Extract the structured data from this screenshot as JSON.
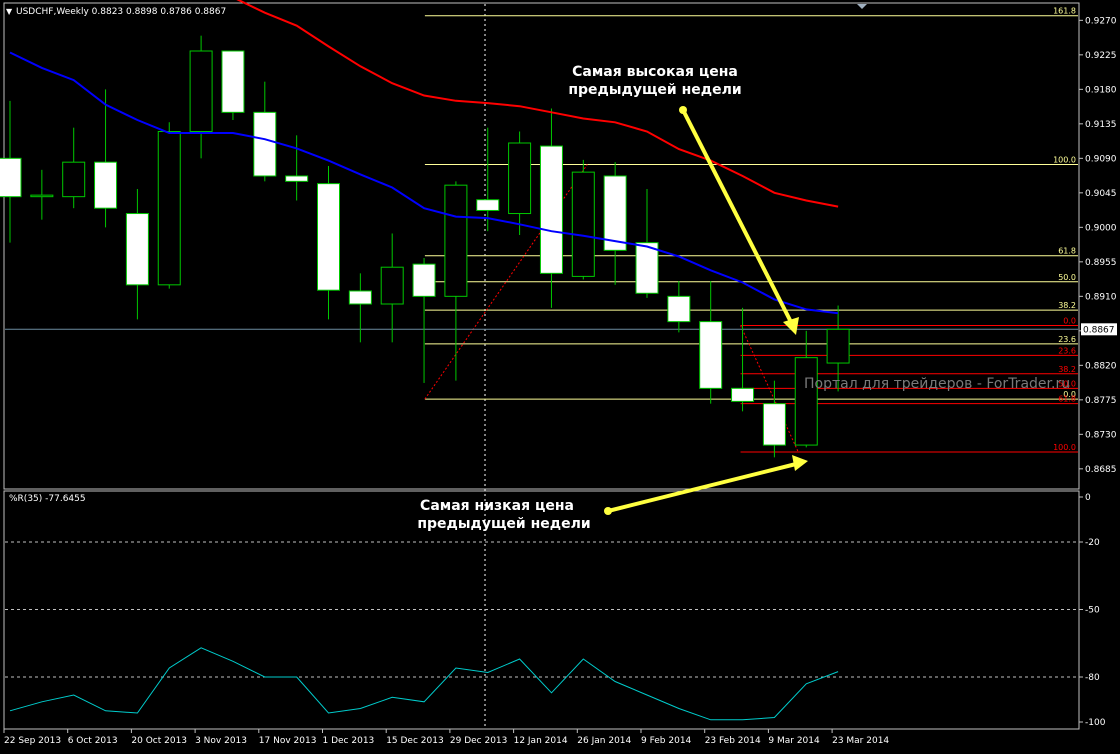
{
  "header": {
    "symbol_line": "USDCHF,Weekly  0.8823 0.8898 0.8786 0.8867",
    "menu_icon": "triangle-down-icon"
  },
  "indicator": {
    "title": "%R(35) -77.6455"
  },
  "watermark": "Портал для трейдеров - ForTrader.ru",
  "annotations": {
    "high_line1": "Самая высокая цена",
    "high_line2": "предыдущей недели",
    "low_line1": "Самая низкая цена",
    "low_line2": "предыдущей недели"
  },
  "colors": {
    "background": "#000000",
    "grid": "#c0c0c0",
    "candle_up": "#000000",
    "candle_down": "#ffffff",
    "candle_outline": "#00c800",
    "ma_fast": "#0000ff",
    "ma_slow": "#ff0000",
    "fib_main": "#ffff99",
    "fib_red": "#ff0000",
    "arrow": "#ffff40",
    "wpr_line": "#00cccc",
    "current_price": "#6c8ca0"
  },
  "chart_data": [
    {
      "type": "candlestick",
      "title": "USDCHF,Weekly",
      "ylim": [
        0.866,
        0.929
      ],
      "y_ticks": [
        "0.9270",
        "0.9225",
        "0.9180",
        "0.9135",
        "0.9090",
        "0.9045",
        "0.9000",
        "0.8955",
        "0.8910",
        "0.8865",
        "0.8820",
        "0.8775",
        "0.8730",
        "0.8685"
      ],
      "current_price_label": "0.8867",
      "x_tick_labels": [
        {
          "bar": 0,
          "label": "22 Sep 2013"
        },
        {
          "bar": 2,
          "label": "6 Oct 2013"
        },
        {
          "bar": 4,
          "label": "20 Oct 2013"
        },
        {
          "bar": 6,
          "label": "3 Nov 2013"
        },
        {
          "bar": 8,
          "label": "17 Nov 2013"
        },
        {
          "bar": 10,
          "label": "1 Dec 2013"
        },
        {
          "bar": 12,
          "label": "15 Dec 2013"
        },
        {
          "bar": 14,
          "label": "29 Dec 2013"
        },
        {
          "bar": 16,
          "label": "12 Jan 2014"
        },
        {
          "bar": 18,
          "label": "26 Jan 2014"
        },
        {
          "bar": 20,
          "label": "9 Feb 2014"
        },
        {
          "bar": 22,
          "label": "23 Feb 2014"
        },
        {
          "bar": 24,
          "label": "9 Mar 2014"
        },
        {
          "bar": 26,
          "label": "23 Mar 2014"
        }
      ],
      "candles": [
        {
          "o": 0.909,
          "h": 0.9165,
          "l": 0.898,
          "c": 0.904
        },
        {
          "o": 0.904,
          "h": 0.9075,
          "l": 0.901,
          "c": 0.9042
        },
        {
          "o": 0.904,
          "h": 0.913,
          "l": 0.9025,
          "c": 0.9085
        },
        {
          "o": 0.9085,
          "h": 0.918,
          "l": 0.9,
          "c": 0.9025
        },
        {
          "o": 0.9018,
          "h": 0.905,
          "l": 0.888,
          "c": 0.8925
        },
        {
          "o": 0.8925,
          "h": 0.9137,
          "l": 0.892,
          "c": 0.9125
        },
        {
          "o": 0.9125,
          "h": 0.925,
          "l": 0.909,
          "c": 0.923
        },
        {
          "o": 0.923,
          "h": 0.923,
          "l": 0.914,
          "c": 0.915
        },
        {
          "o": 0.915,
          "h": 0.919,
          "l": 0.906,
          "c": 0.9067
        },
        {
          "o": 0.9067,
          "h": 0.912,
          "l": 0.9035,
          "c": 0.906
        },
        {
          "o": 0.9057,
          "h": 0.908,
          "l": 0.888,
          "c": 0.8918
        },
        {
          "o": 0.8917,
          "h": 0.894,
          "l": 0.885,
          "c": 0.89
        },
        {
          "o": 0.89,
          "h": 0.8992,
          "l": 0.885,
          "c": 0.8948
        },
        {
          "o": 0.8952,
          "h": 0.896,
          "l": 0.8797,
          "c": 0.891
        },
        {
          "o": 0.891,
          "h": 0.906,
          "l": 0.88,
          "c": 0.9055
        },
        {
          "o": 0.9036,
          "h": 0.913,
          "l": 0.8995,
          "c": 0.9022
        },
        {
          "o": 0.9018,
          "h": 0.9125,
          "l": 0.899,
          "c": 0.911
        },
        {
          "o": 0.9106,
          "h": 0.9155,
          "l": 0.8895,
          "c": 0.894
        },
        {
          "o": 0.8936,
          "h": 0.9088,
          "l": 0.8932,
          "c": 0.9072
        },
        {
          "o": 0.9067,
          "h": 0.9085,
          "l": 0.8925,
          "c": 0.897
        },
        {
          "o": 0.898,
          "h": 0.905,
          "l": 0.8908,
          "c": 0.8914
        },
        {
          "o": 0.891,
          "h": 0.893,
          "l": 0.8863,
          "c": 0.8877
        },
        {
          "o": 0.8877,
          "h": 0.893,
          "l": 0.877,
          "c": 0.879
        },
        {
          "o": 0.879,
          "h": 0.8895,
          "l": 0.876,
          "c": 0.8773
        },
        {
          "o": 0.877,
          "h": 0.88,
          "l": 0.87,
          "c": 0.8716
        },
        {
          "o": 0.8716,
          "h": 0.8865,
          "l": 0.8713,
          "c": 0.883
        },
        {
          "o": 0.8823,
          "h": 0.8898,
          "l": 0.8786,
          "c": 0.8867
        }
      ],
      "ma_fast": [
        {
          "bar": 0,
          "v": 0.9228
        },
        {
          "bar": 1,
          "v": 0.9208
        },
        {
          "bar": 2,
          "v": 0.9192
        },
        {
          "bar": 3,
          "v": 0.916
        },
        {
          "bar": 4,
          "v": 0.914
        },
        {
          "bar": 5,
          "v": 0.9123
        },
        {
          "bar": 6,
          "v": 0.9123
        },
        {
          "bar": 7,
          "v": 0.9123
        },
        {
          "bar": 8,
          "v": 0.9115
        },
        {
          "bar": 9,
          "v": 0.9103
        },
        {
          "bar": 10,
          "v": 0.9087
        },
        {
          "bar": 11,
          "v": 0.9069
        },
        {
          "bar": 12,
          "v": 0.9052
        },
        {
          "bar": 13,
          "v": 0.9025
        },
        {
          "bar": 14,
          "v": 0.9014
        },
        {
          "bar": 15,
          "v": 0.9012
        },
        {
          "bar": 16,
          "v": 0.9004
        },
        {
          "bar": 17,
          "v": 0.8995
        },
        {
          "bar": 18,
          "v": 0.8989
        },
        {
          "bar": 19,
          "v": 0.8982
        },
        {
          "bar": 20,
          "v": 0.8975
        },
        {
          "bar": 21,
          "v": 0.8962
        },
        {
          "bar": 22,
          "v": 0.8944
        },
        {
          "bar": 23,
          "v": 0.8928
        },
        {
          "bar": 24,
          "v": 0.8906
        },
        {
          "bar": 25,
          "v": 0.8893
        },
        {
          "bar": 26,
          "v": 0.8888
        }
      ],
      "ma_slow": [
        {
          "bar": 7,
          "v": 0.93
        },
        {
          "bar": 8,
          "v": 0.928
        },
        {
          "bar": 9,
          "v": 0.9263
        },
        {
          "bar": 10,
          "v": 0.9236
        },
        {
          "bar": 11,
          "v": 0.921
        },
        {
          "bar": 12,
          "v": 0.9188
        },
        {
          "bar": 13,
          "v": 0.9172
        },
        {
          "bar": 14,
          "v": 0.9165
        },
        {
          "bar": 15,
          "v": 0.9162
        },
        {
          "bar": 16,
          "v": 0.9158
        },
        {
          "bar": 17,
          "v": 0.915
        },
        {
          "bar": 18,
          "v": 0.9142
        },
        {
          "bar": 19,
          "v": 0.9137
        },
        {
          "bar": 20,
          "v": 0.9125
        },
        {
          "bar": 21,
          "v": 0.9102
        },
        {
          "bar": 22,
          "v": 0.9087
        },
        {
          "bar": 23,
          "v": 0.9067
        },
        {
          "bar": 24,
          "v": 0.9045
        },
        {
          "bar": 25,
          "v": 0.9035
        },
        {
          "bar": 26,
          "v": 0.9027
        }
      ],
      "fib_main": {
        "from_bar": 14,
        "to_bar": 34,
        "anchor_low": 0.8776,
        "anchor_high": 0.9082,
        "levels": [
          {
            "label": "161.8",
            "price": 0.9276
          },
          {
            "label": "100.0",
            "price": 0.9082
          },
          {
            "label": "61.8",
            "price": 0.8963
          },
          {
            "label": "50.0",
            "price": 0.8929
          },
          {
            "label": "38.2",
            "price": 0.8892
          },
          {
            "label": "23.6",
            "price": 0.8848
          },
          {
            "label": "0.0",
            "price": 0.8776
          }
        ]
      },
      "fib_red": {
        "from_bar": 23,
        "to_bar": 34,
        "anchor_high": 0.8872,
        "anchor_low": 0.8707,
        "levels": [
          {
            "label": "0.0",
            "price": 0.8872
          },
          {
            "label": "23.6",
            "price": 0.8833
          },
          {
            "label": "38.2",
            "price": 0.8809
          },
          {
            "label": "50.0",
            "price": 0.879
          },
          {
            "label": "61.8",
            "price": 0.877
          },
          {
            "label": "100.0",
            "price": 0.8707
          }
        ]
      }
    },
    {
      "type": "line",
      "title": "%R(35) -77.6455",
      "ylim": [
        -100,
        0
      ],
      "y_ticks": [
        "0",
        "-20",
        "-50",
        "-80",
        "-100"
      ],
      "hlines": [
        -20,
        -50,
        -80
      ],
      "series": [
        {
          "values": [
            -95,
            -91,
            -88,
            -95,
            -96,
            -76,
            -67,
            -73,
            -80,
            -80,
            -96,
            -94,
            -89,
            -91,
            -76,
            -78,
            -72,
            -87,
            -72,
            -82,
            -88,
            -94,
            -99,
            -99,
            -98,
            -83,
            -77.6
          ]
        }
      ]
    }
  ]
}
